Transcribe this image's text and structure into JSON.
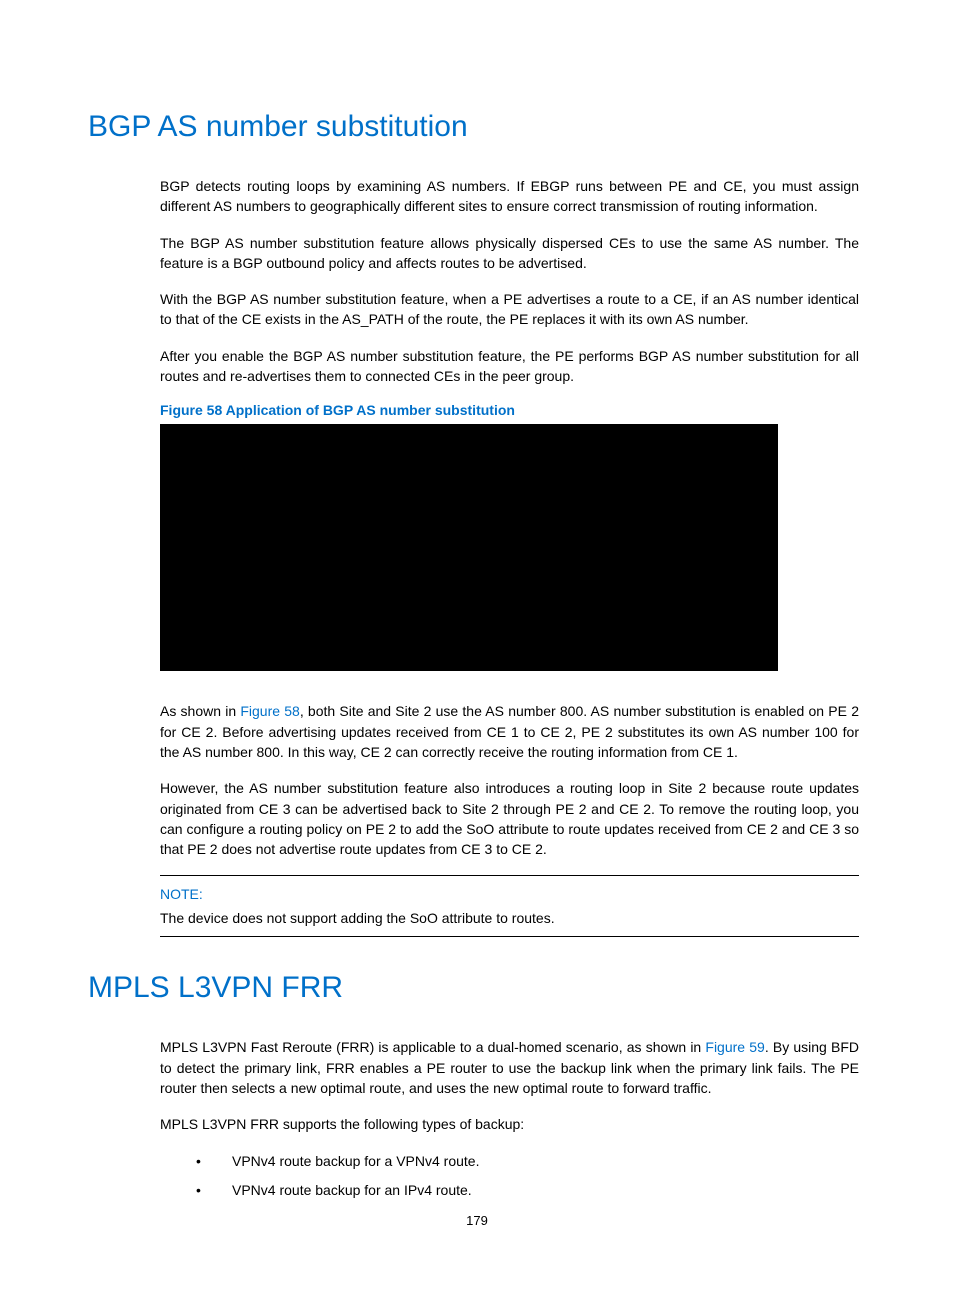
{
  "section1": {
    "heading": "BGP AS number substitution",
    "para1": "BGP detects routing loops by examining AS numbers. If EBGP runs between PE and CE, you must assign different AS numbers to geographically different sites to ensure correct transmission of routing information.",
    "para2": "The BGP AS number substitution feature allows physically dispersed CEs to use the same AS number. The feature is a BGP outbound policy and affects routes to be advertised.",
    "para3": "With the BGP AS number substitution feature, when a PE advertises a route to a CE, if an AS number identical to that of the CE exists in the AS_PATH of the route, the PE replaces it with its own AS number.",
    "para4": "After you enable the BGP AS number substitution feature, the PE performs BGP AS number substitution for all routes and re-advertises them to connected CEs in the peer group.",
    "figure_caption": "Figure 58 Application of BGP AS number substitution",
    "para5_prefix": "As shown in ",
    "para5_ref": "Figure 58",
    "para5_suffix": ", both Site and Site 2 use the AS number 800. AS number substitution is enabled on PE 2 for CE 2. Before advertising updates received from CE 1 to CE 2, PE 2 substitutes its own AS number 100 for the AS number 800. In this way, CE 2 can correctly receive the routing information from CE 1.",
    "para6": "However, the AS number substitution feature also introduces a routing loop in Site 2 because route updates originated from CE 3 can be advertised back to Site 2 through PE 2 and CE 2. To remove the routing loop, you can configure a routing policy on PE 2 to add the SoO attribute to route updates received from CE 2 and CE 3 so that PE 2 does not advertise route updates from CE 3 to CE 2.",
    "note_label": "NOTE:",
    "note_content": "The device does not support adding the SoO attribute to routes."
  },
  "section2": {
    "heading": "MPLS L3VPN FRR",
    "para1_prefix": "MPLS L3VPN Fast Reroute (FRR) is applicable to a dual-homed scenario, as shown in ",
    "para1_ref": "Figure 59",
    "para1_suffix": ". By using BFD to detect the primary link, FRR enables a PE router to use the backup link when the primary link fails. The PE router then selects a new optimal route, and uses the new optimal route to forward traffic.",
    "para2": "MPLS L3VPN FRR supports the following types of backup:",
    "bullet1": "VPNv4 route backup for a VPNv4 route.",
    "bullet2": "VPNv4 route backup for an IPv4 route."
  },
  "page_number": "179"
}
